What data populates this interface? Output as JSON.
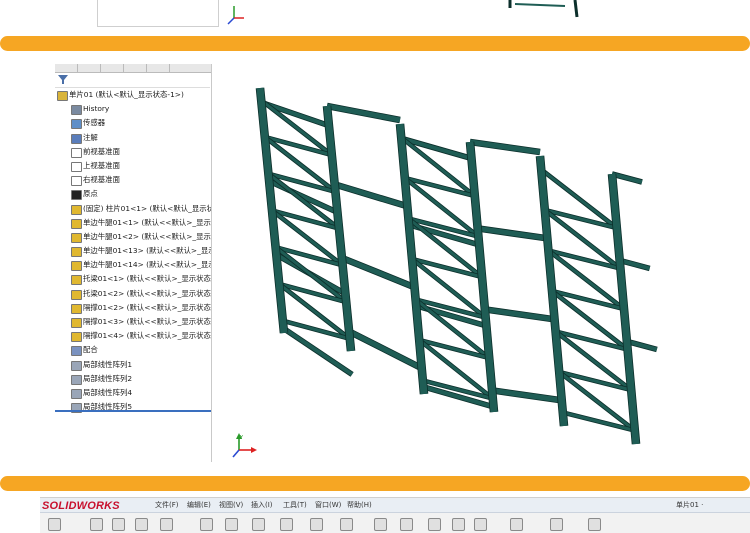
{
  "colors": {
    "band": "#f6a623",
    "rack": "#1f5d55",
    "rack_edge": "#0c2f2b",
    "logo_red": "#c8102e"
  },
  "feature_tree": {
    "tabs": [
      "",
      "",
      "",
      "",
      ""
    ],
    "filter_icon": "funnel-icon",
    "items": [
      {
        "label": "单片01 (默认<默认_显示状态-1>)",
        "icon": "part-icon",
        "arrow": false,
        "indent": 0
      },
      {
        "label": "History",
        "icon": "history-icon",
        "arrow": true,
        "indent": 1
      },
      {
        "label": "传感器",
        "icon": "sensor-icon",
        "arrow": false,
        "indent": 1
      },
      {
        "label": "注解",
        "icon": "annotation-icon",
        "arrow": true,
        "indent": 1
      },
      {
        "label": "前视基准面",
        "icon": "plane-icon",
        "arrow": false,
        "indent": 1
      },
      {
        "label": "上视基准面",
        "icon": "plane-icon",
        "arrow": false,
        "indent": 1
      },
      {
        "label": "右视基准面",
        "icon": "plane-icon",
        "arrow": false,
        "indent": 1
      },
      {
        "label": "原点",
        "icon": "origin-icon",
        "arrow": false,
        "indent": 1
      },
      {
        "label": "(固定) 柱片01<1> (默认<默认_显示状",
        "icon": "component-icon",
        "arrow": true,
        "indent": 1
      },
      {
        "label": "单边牛腿01<1> (默认<<默认>_显示状",
        "icon": "component-icon",
        "arrow": true,
        "indent": 1
      },
      {
        "label": "单边牛腿01<2> (默认<<默认>_显示状",
        "icon": "component-icon",
        "arrow": true,
        "indent": 1
      },
      {
        "label": "单边牛腿01<13> (默认<<默认>_显示",
        "icon": "component-icon",
        "arrow": true,
        "indent": 1
      },
      {
        "label": "单边牛腿01<14> (默认<<默认>_显示",
        "icon": "component-icon",
        "arrow": true,
        "indent": 1
      },
      {
        "label": "托梁01<1> (默认<<默认>_显示状态",
        "icon": "component-icon",
        "arrow": true,
        "indent": 1
      },
      {
        "label": "托梁01<2> (默认<<默认>_显示状态",
        "icon": "component-icon",
        "arrow": true,
        "indent": 1
      },
      {
        "label": "隔撑01<2> (默认<<默认>_显示状态",
        "icon": "component-icon",
        "arrow": true,
        "indent": 1
      },
      {
        "label": "隔撑01<3> (默认<<默认>_显示状态",
        "icon": "component-icon",
        "arrow": true,
        "indent": 1
      },
      {
        "label": "隔撑01<4> (默认<<默认>_显示状态",
        "icon": "component-icon",
        "arrow": true,
        "indent": 1
      },
      {
        "label": "配合",
        "icon": "mate-icon",
        "arrow": true,
        "indent": 1
      },
      {
        "label": "局部线性阵列1",
        "icon": "pattern-icon",
        "arrow": true,
        "indent": 1
      },
      {
        "label": "局部线性阵列2",
        "icon": "pattern-icon",
        "arrow": true,
        "indent": 1
      },
      {
        "label": "局部线性阵列4",
        "icon": "pattern-icon",
        "arrow": true,
        "indent": 1
      },
      {
        "label": "局部线性阵列5",
        "icon": "pattern-icon",
        "arrow": true,
        "indent": 1
      }
    ]
  },
  "viewport": {
    "triad": "axis-triad-icon",
    "model": "shelving-rack-model"
  },
  "toolbar": {
    "logo": "SOLIDWORKS",
    "menu": [
      "文件(F)",
      "编辑(E)",
      "视图(V)",
      "插入(I)",
      "工具(T)",
      "窗口(W)",
      "帮助(H)"
    ],
    "doc_title": "单片01 ·"
  }
}
